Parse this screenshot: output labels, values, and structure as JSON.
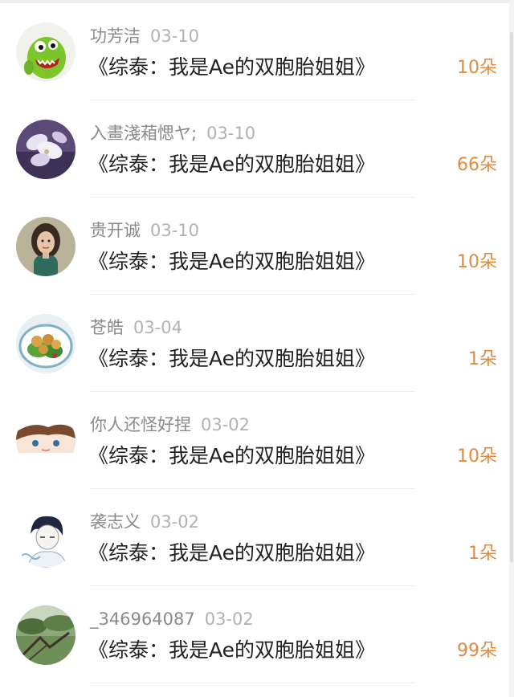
{
  "entries": [
    {
      "name": "功芳洁",
      "date": "03-10",
      "title": "《综泰：我是Ae的双胞胎姐姐》",
      "count": "10朵",
      "avatar": "green-monster-toy-icon"
    },
    {
      "name": "入畫淺葙愢ヤ;",
      "date": "03-10",
      "title": "《综泰：我是Ae的双胞胎姐姐》",
      "count": "66朵",
      "avatar": "white-flowers-icon"
    },
    {
      "name": "贵开诚",
      "date": "03-10",
      "title": "《综泰：我是Ae的双胞胎姐姐》",
      "count": "10朵",
      "avatar": "woman-portrait-icon"
    },
    {
      "name": "苍皓",
      "date": "03-04",
      "title": "《综泰：我是Ae的双胞胎姐姐》",
      "count": "1朵",
      "avatar": "food-plate-icon"
    },
    {
      "name": "你人还怪好捏",
      "date": "03-02",
      "title": "《综泰：我是Ae的双胞胎姐姐》",
      "count": "10朵",
      "avatar": "anime-boy-icon"
    },
    {
      "name": "袭志义",
      "date": "03-02",
      "title": "《综泰：我是Ae的双胞胎姐姐》",
      "count": "1朵",
      "avatar": "anime-sketch-boy-icon"
    },
    {
      "name": "_346964087",
      "date": "03-02",
      "title": "《综泰：我是Ae的双胞胎姐姐》",
      "count": "99朵",
      "avatar": "landscape-trees-icon"
    }
  ],
  "colors": {
    "count": "#e38a3e",
    "name": "#8a8a8a",
    "date": "#b2b2b2",
    "title": "#222222"
  }
}
